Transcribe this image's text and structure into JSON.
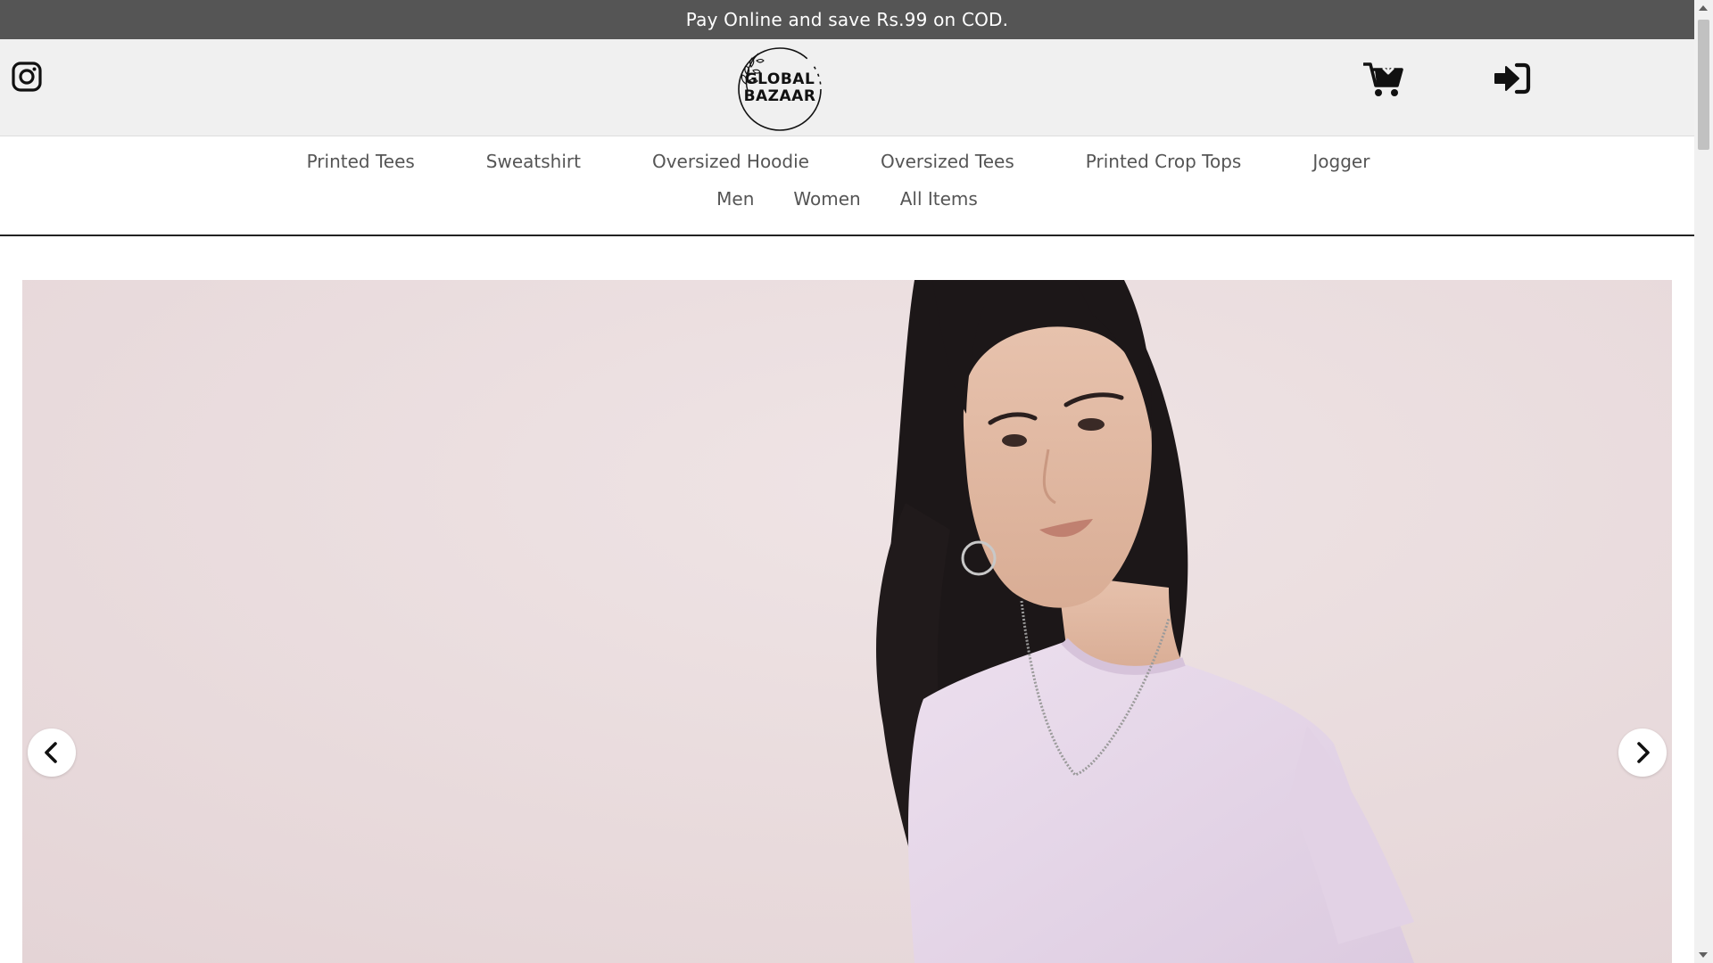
{
  "announcement": {
    "text": "Pay Online and save Rs.99 on COD."
  },
  "header": {
    "instagram_icon": "instagram-icon",
    "logo": {
      "line1": "GLOBAL",
      "line2": "BAZAAR"
    },
    "cart_icon": "cart-icon",
    "signin_icon": "sign-in-icon"
  },
  "nav": {
    "primary": [
      {
        "label": "Printed Tees"
      },
      {
        "label": "Sweatshirt"
      },
      {
        "label": "Oversized Hoodie"
      },
      {
        "label": "Oversized Tees"
      },
      {
        "label": "Printed Crop Tops"
      },
      {
        "label": "Jogger"
      }
    ],
    "secondary": [
      {
        "label": "Men"
      },
      {
        "label": "Women"
      },
      {
        "label": "All Items"
      }
    ]
  },
  "hero": {
    "background_color": "#ecdfe0",
    "tee_color": "#ead9ea",
    "prev_icon": "chevron-left-icon",
    "next_icon": "chevron-right-icon"
  },
  "colors": {
    "announcement_bg": "#555555",
    "header_bg": "#f0f0f0",
    "nav_text": "#555555"
  }
}
